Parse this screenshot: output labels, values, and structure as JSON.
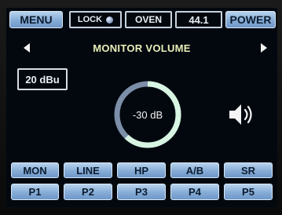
{
  "topbar": {
    "menu_label": "MENU",
    "lock_label": "LOCK",
    "oven_label": "OVEN",
    "value_readout": "44.1",
    "power_label": "POWER"
  },
  "monitor": {
    "title": "MONITOR VOLUME",
    "reference_level": "20 dBu",
    "volume_label": "-30 dB",
    "ring_fill_fraction": 0.62
  },
  "mode_buttons": [
    "MON",
    "LINE",
    "HP",
    "A/B",
    "SR"
  ],
  "preset_buttons": [
    "P1",
    "P2",
    "P3",
    "P4",
    "P5"
  ],
  "icons": {
    "left": "left-arrow-icon",
    "right": "right-arrow-icon",
    "lock": "lock-indicator-icon",
    "speaker": "speaker-icon"
  },
  "colors": {
    "button_blue": "#8fb3dc",
    "title_yellow": "#e8f0b8",
    "ring_green": "#d7f5e2",
    "ring_track": "#7c8ea8"
  }
}
